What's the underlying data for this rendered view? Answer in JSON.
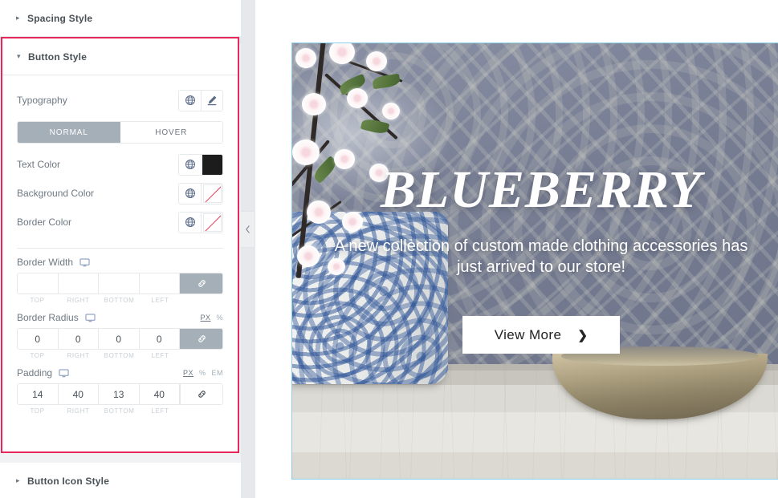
{
  "panel": {
    "sections": [
      {
        "id": "spacing-style",
        "title": "Spacing Style",
        "expanded": false,
        "caret": "▸"
      },
      {
        "id": "button-style",
        "title": "Button Style",
        "expanded": true,
        "caret": "▾"
      },
      {
        "id": "button-icon-style",
        "title": "Button Icon Style",
        "expanded": false,
        "caret": "▸"
      }
    ],
    "controls": {
      "typography": {
        "label": "Typography",
        "globe_icon": "globe-icon",
        "edit_icon": "pencil-icon"
      },
      "state_tabs": {
        "normal": "NORMAL",
        "hover": "HOVER",
        "active": "NORMAL"
      },
      "text_color": {
        "label": "Text Color",
        "globe_icon": "globe-icon",
        "swatch": "#1c1c1c",
        "swatch_empty": false
      },
      "background_color": {
        "label": "Background Color",
        "globe_icon": "globe-icon",
        "swatch": "",
        "swatch_empty": true
      },
      "border_color": {
        "label": "Border Color",
        "globe_icon": "globe-icon",
        "swatch": "",
        "swatch_empty": true
      },
      "border_width": {
        "label": "Border Width",
        "device_icon": "monitor-icon",
        "units": [],
        "active_unit": "",
        "values": {
          "top": "",
          "right": "",
          "bottom": "",
          "left": ""
        },
        "sides": {
          "top": "TOP",
          "right": "RIGHT",
          "bottom": "BOTTOM",
          "left": "LEFT"
        },
        "link_icon": "link-icon",
        "linked": true
      },
      "border_radius": {
        "label": "Border Radius",
        "device_icon": "monitor-icon",
        "units": [
          "PX",
          "%"
        ],
        "active_unit": "PX",
        "values": {
          "top": "0",
          "right": "0",
          "bottom": "0",
          "left": "0"
        },
        "sides": {
          "top": "TOP",
          "right": "RIGHT",
          "bottom": "BOTTOM",
          "left": "LEFT"
        },
        "link_icon": "link-icon",
        "linked": true
      },
      "padding": {
        "label": "Padding",
        "device_icon": "monitor-icon",
        "units": [
          "PX",
          "%",
          "EM"
        ],
        "active_unit": "PX",
        "values": {
          "top": "14",
          "right": "40",
          "bottom": "13",
          "left": "40"
        },
        "sides": {
          "top": "TOP",
          "right": "RIGHT",
          "bottom": "BOTTOM",
          "left": "LEFT"
        },
        "link_icon": "link-icon",
        "linked": false
      }
    },
    "collapse_handle_icon": "chevron-left-icon",
    "highlight_color": "#e8275a",
    "active_tab_color": "#a4afb7"
  },
  "preview": {
    "hero": {
      "title": "BLUEBERRY",
      "subtitle": "A new collection of custom made clothing accessories has just arrived to our store!",
      "button_label": "View More",
      "button_icon": "chevron-right-icon",
      "button_background": "#ffffff",
      "button_text_color": "#222222",
      "title_color": "#ffffff"
    }
  }
}
